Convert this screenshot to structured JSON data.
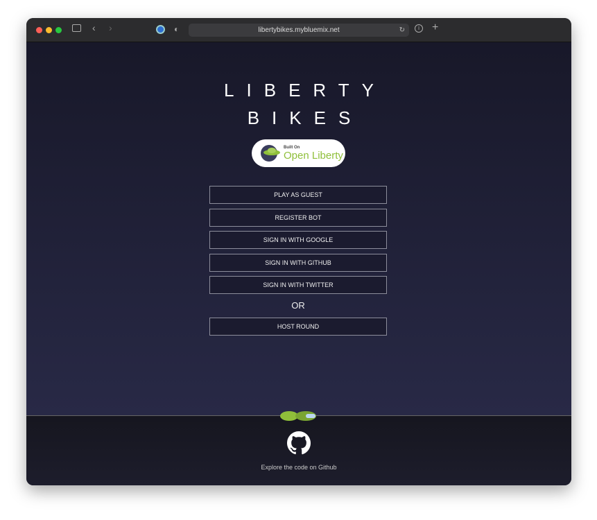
{
  "browser": {
    "url": "libertybikes.mybluemix.net"
  },
  "title": {
    "line1": "LIBERTY",
    "line2": "BIKES"
  },
  "badge": {
    "small": "Built On",
    "big": "Open Liberty"
  },
  "buttons": [
    "PLAY AS GUEST",
    "REGISTER BOT",
    "SIGN IN WITH GOOGLE",
    "SIGN IN WITH GITHUB",
    "SIGN IN WITH TWITTER"
  ],
  "or_label": "OR",
  "host_button": "HOST ROUND",
  "footer": {
    "link": "Explore the code on Github"
  },
  "colors": {
    "accent": "#8fbf3a",
    "background": "#1a1a2c"
  }
}
